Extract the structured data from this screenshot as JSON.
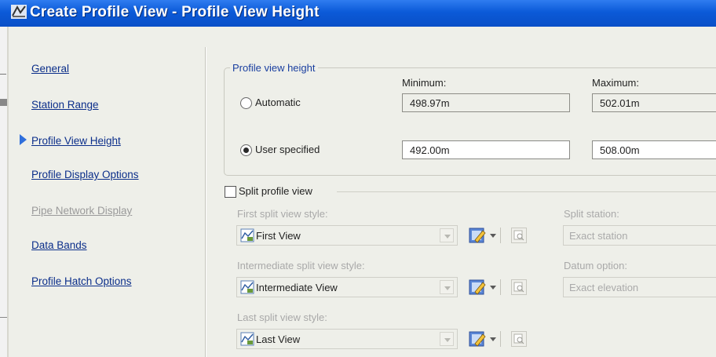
{
  "window": {
    "title": "Create Profile View - Profile View Height"
  },
  "nav": {
    "items": [
      {
        "label": "General",
        "state": "enabled"
      },
      {
        "label": "Station Range",
        "state": "enabled"
      },
      {
        "label": "Profile View Height",
        "state": "current"
      },
      {
        "label": "Profile Display Options",
        "state": "enabled"
      },
      {
        "label": "Pipe Network Display",
        "state": "disabled"
      },
      {
        "label": "Data Bands",
        "state": "enabled"
      },
      {
        "label": "Profile Hatch Options",
        "state": "enabled"
      }
    ]
  },
  "height_group": {
    "title": "Profile view height",
    "min_header": "Minimum:",
    "max_header": "Maximum:",
    "automatic": {
      "label": "Automatic",
      "selected": false,
      "min": "498.97m",
      "max": "502.01m"
    },
    "user_specified": {
      "label": "User specified",
      "selected": true,
      "min": "492.00m",
      "max": "508.00m"
    }
  },
  "split": {
    "checkbox_label": "Split profile view",
    "checked": false,
    "first_style_label": "First split view style:",
    "first_style_value": "First View",
    "intermediate_style_label": "Intermediate split view style:",
    "intermediate_style_value": "Intermediate View",
    "last_style_label": "Last split view style:",
    "last_style_value": "Last View",
    "split_station_label": "Split station:",
    "split_station_value": "Exact station",
    "datum_option_label": "Datum option:",
    "datum_option_value": "Exact elevation"
  },
  "colors": {
    "titlebar": "#0b5ad8",
    "dialog_bg": "#eeefe9",
    "link": "#0b2e8a",
    "current_arrow": "#2f6fdc"
  },
  "icons": {
    "titlebar": "app-icon",
    "current_marker": "triangle-right-icon",
    "style": "profile-view-style-icon",
    "edit": "edit-style-icon",
    "view": "view-style-icon"
  }
}
